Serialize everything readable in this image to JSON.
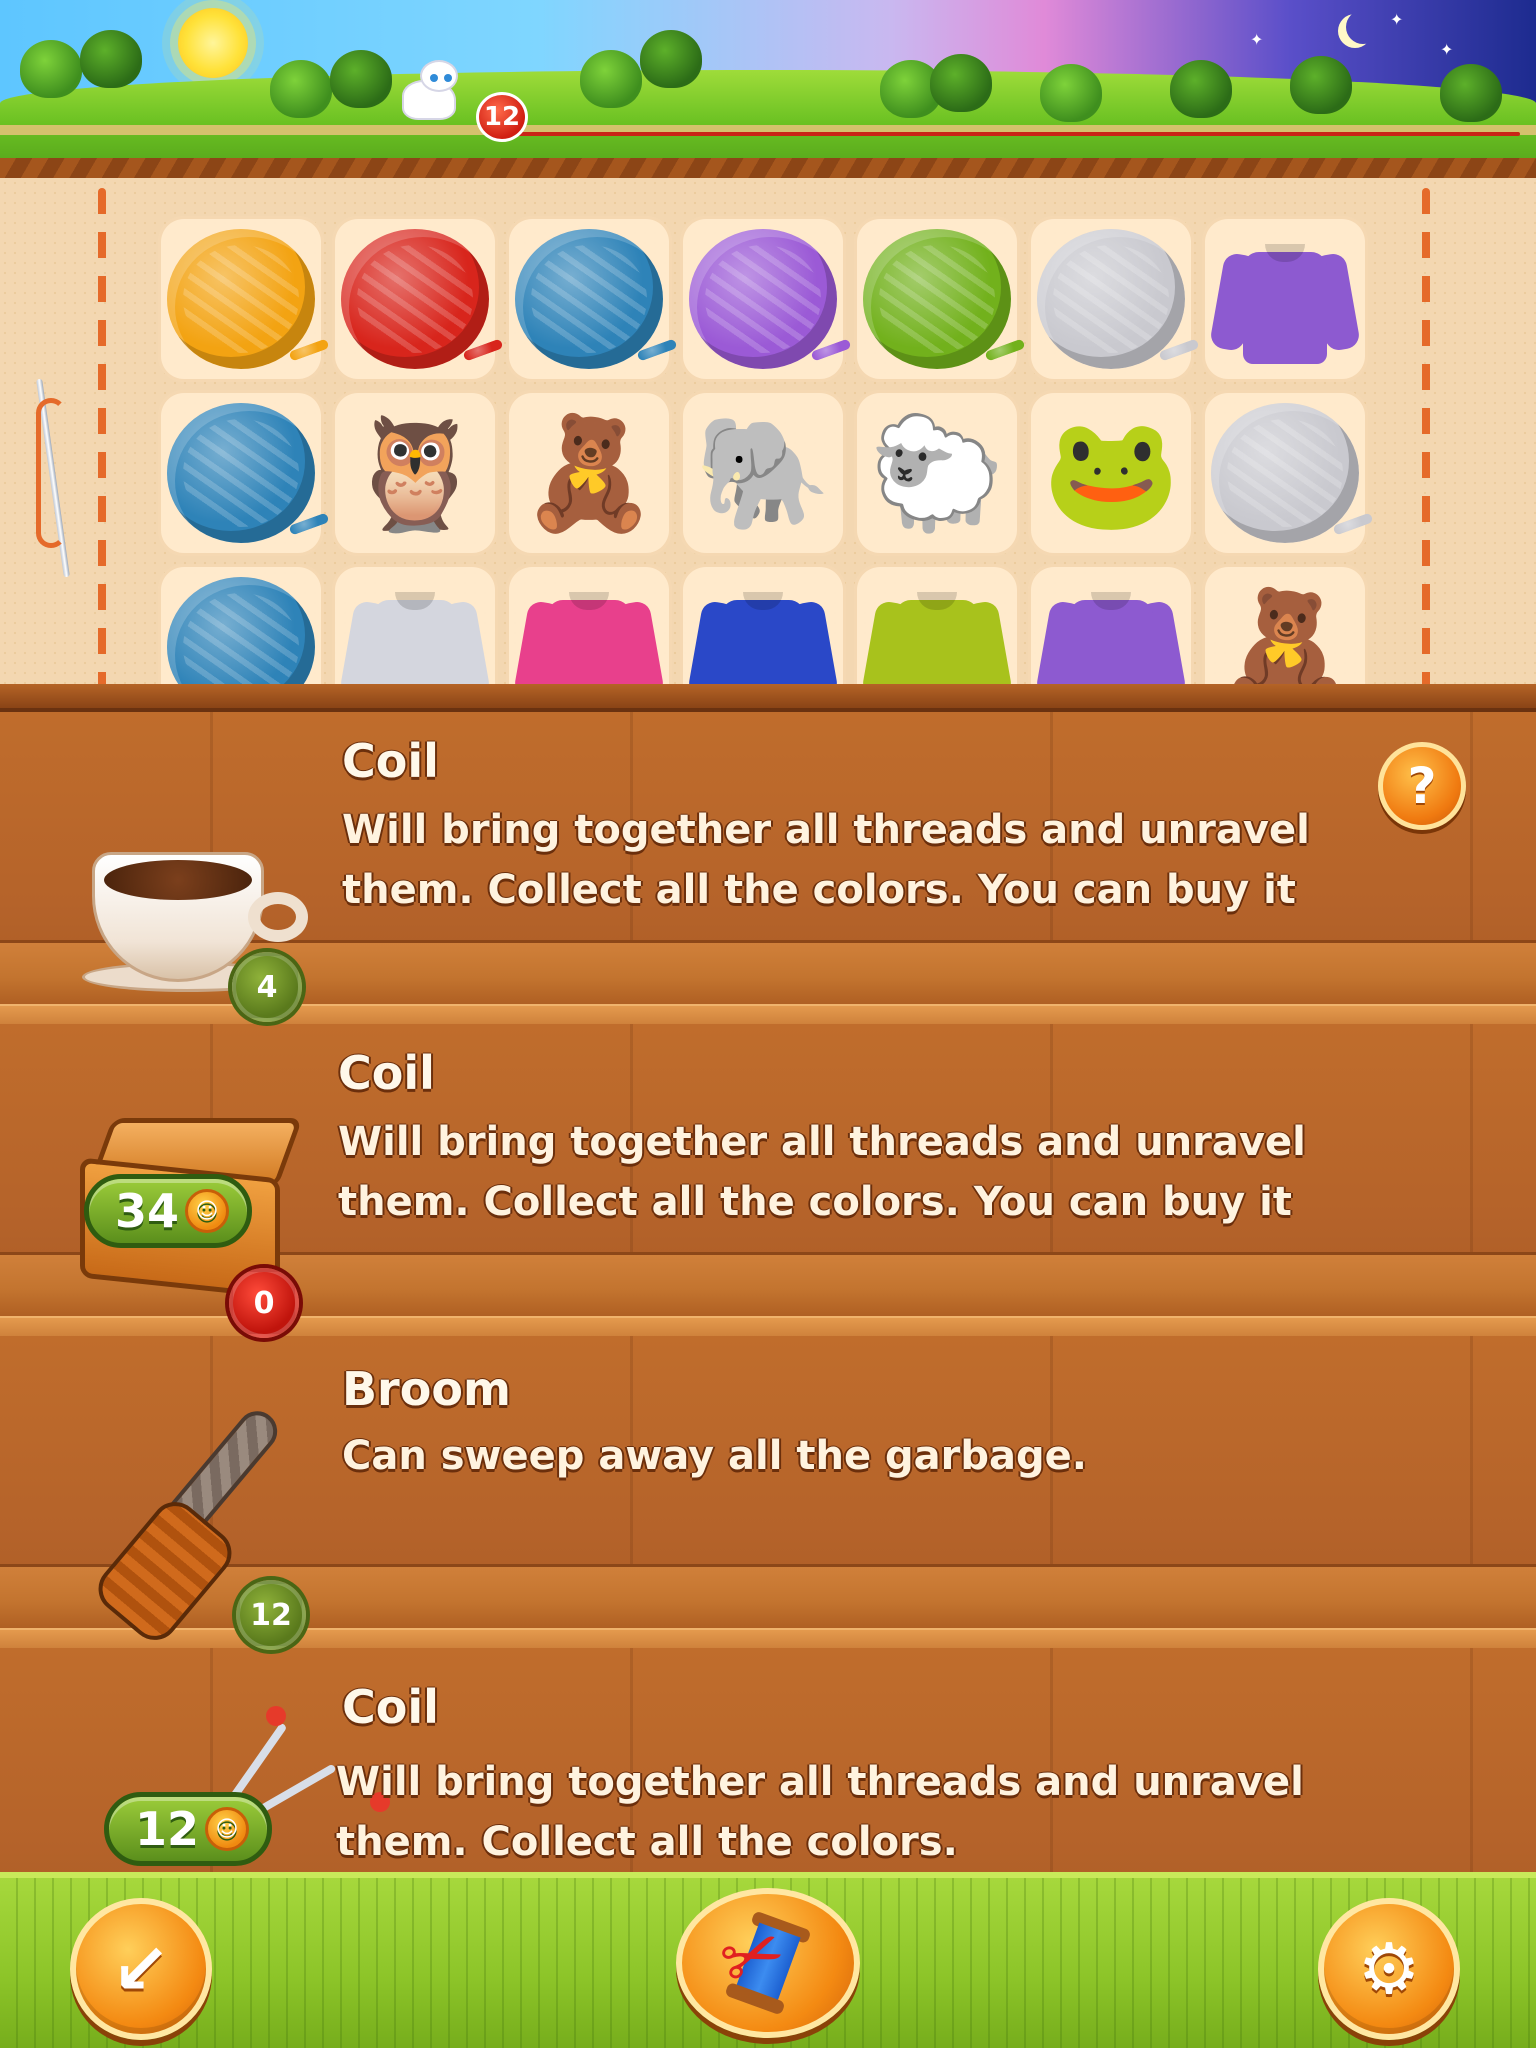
{
  "banner": {
    "level": "12",
    "colors": {
      "progress": "#c92416",
      "badge": "#d01e12"
    }
  },
  "board": {
    "rows": [
      [
        {
          "type": "yarn",
          "icon": "golden-yarn-ball",
          "color": "#f3a312"
        },
        {
          "type": "yarn",
          "icon": "red-yarn-ball",
          "color": "#d8251c"
        },
        {
          "type": "yarn",
          "icon": "blue-yarn-ball",
          "color": "#2e83b8"
        },
        {
          "type": "yarn",
          "icon": "purple-yarn-ball",
          "color": "#9b5ad6"
        },
        {
          "type": "yarn",
          "icon": "green-yarn-ball",
          "color": "#72b11c"
        },
        {
          "type": "yarn",
          "icon": "white-yarn-ball",
          "color": "#c9c9cf"
        },
        {
          "type": "sweater",
          "icon": "purple-sweater",
          "color": "#8d5ad0"
        }
      ],
      [
        {
          "type": "yarn",
          "icon": "blue-yarn-ball",
          "color": "#2e83b8"
        },
        {
          "type": "toy",
          "icon": "owl-toy",
          "glyph": "🦉"
        },
        {
          "type": "toy",
          "icon": "teddy-bear-toy",
          "glyph": "🧸"
        },
        {
          "type": "toy",
          "icon": "elephant-toy",
          "glyph": "🐘"
        },
        {
          "type": "toy",
          "icon": "sheep-toy",
          "glyph": "🐑"
        },
        {
          "type": "toy",
          "icon": "frog-toy",
          "glyph": "🐸"
        },
        {
          "type": "yarn",
          "icon": "white-yarn-ball",
          "color": "#c9c9cf"
        }
      ],
      [
        {
          "type": "yarn",
          "icon": "blue-yarn-ball",
          "color": "#2e83b8"
        },
        {
          "type": "sweater",
          "icon": "white-sweater",
          "color": "#d4d6de"
        },
        {
          "type": "sweater",
          "icon": "pink-sweater",
          "color": "#e8408c"
        },
        {
          "type": "sweater",
          "icon": "blue-sweater",
          "color": "#2a48c8"
        },
        {
          "type": "sweater",
          "icon": "green-frog-sweater",
          "color": "#a8c21c"
        },
        {
          "type": "sweater",
          "icon": "purple-sweater",
          "color": "#8d5ad0"
        },
        {
          "type": "toy",
          "icon": "teddy-bear-toy",
          "glyph": "🧸"
        }
      ]
    ]
  },
  "shop": {
    "items": [
      {
        "name": "Coil",
        "description": "Will bring together all threads and unravel them. Collect all the colors. You can buy it",
        "icon": "coffee-cup-icon",
        "count": "4",
        "count_style": "green"
      },
      {
        "name": "Coil",
        "description": "Will bring together all threads and unravel them. Collect all the colors. You can buy it",
        "icon": "wooden-box-icon",
        "price": "34",
        "count": "0",
        "count_style": "red"
      },
      {
        "name": "Broom",
        "description": "Can sweep away all the garbage.",
        "icon": "broom-icon",
        "count": "12",
        "count_style": "green"
      },
      {
        "name": "Coil",
        "description": "Will bring together all threads and unravel them. Collect all the colors.",
        "icon": "knitting-needles-icon",
        "price": "12"
      }
    ],
    "help_label": "?"
  },
  "footer": {
    "back_icon": "back-arrow-icon",
    "tools_icon": "scissors-spool-icon",
    "settings_icon": "gear-icon",
    "back_glyph": "↙",
    "settings_glyph": "⚙"
  },
  "colors": {
    "wood": "#b5632a",
    "grass": "#8cc428",
    "accent_orange": "#f48a12",
    "text_cream": "#fff3df"
  }
}
